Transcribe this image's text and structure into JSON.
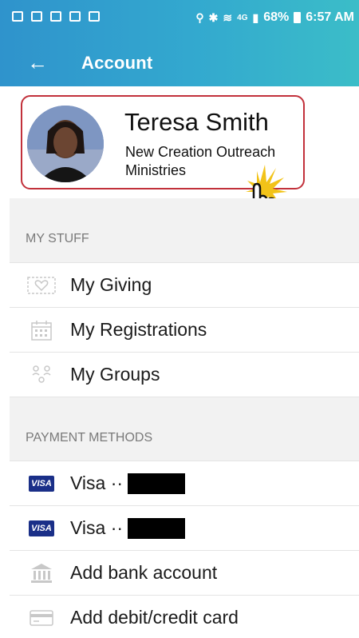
{
  "status_bar": {
    "battery": "68%",
    "time": "6:57 AM",
    "network": "4G"
  },
  "app_bar": {
    "title": "Account",
    "back_icon": "arrow-back-icon"
  },
  "profile": {
    "name": "Teresa Smith",
    "organization": "New Creation Outreach Ministries"
  },
  "my_stuff": {
    "header": "MY STUFF",
    "items": [
      {
        "label": "My Giving",
        "icon": "giving-envelope-icon"
      },
      {
        "label": "My Registrations",
        "icon": "calendar-icon"
      },
      {
        "label": "My Groups",
        "icon": "groups-icon"
      }
    ]
  },
  "payment_methods": {
    "header": "PAYMENT METHODS",
    "items": [
      {
        "label": "Visa ··",
        "icon": "visa-card-icon",
        "badge": "VISA"
      },
      {
        "label": "Visa ··",
        "icon": "visa-card-icon",
        "badge": "VISA"
      },
      {
        "label": "Add bank account",
        "icon": "bank-icon"
      },
      {
        "label": "Add debit/credit card",
        "icon": "credit-card-icon"
      }
    ]
  },
  "colors": {
    "header_start": "#2f93cc",
    "header_end": "#3bbdc8",
    "highlight_border": "#c2313b",
    "section_bg": "#f2f2f2",
    "visa_blue": "#1a2f88"
  }
}
